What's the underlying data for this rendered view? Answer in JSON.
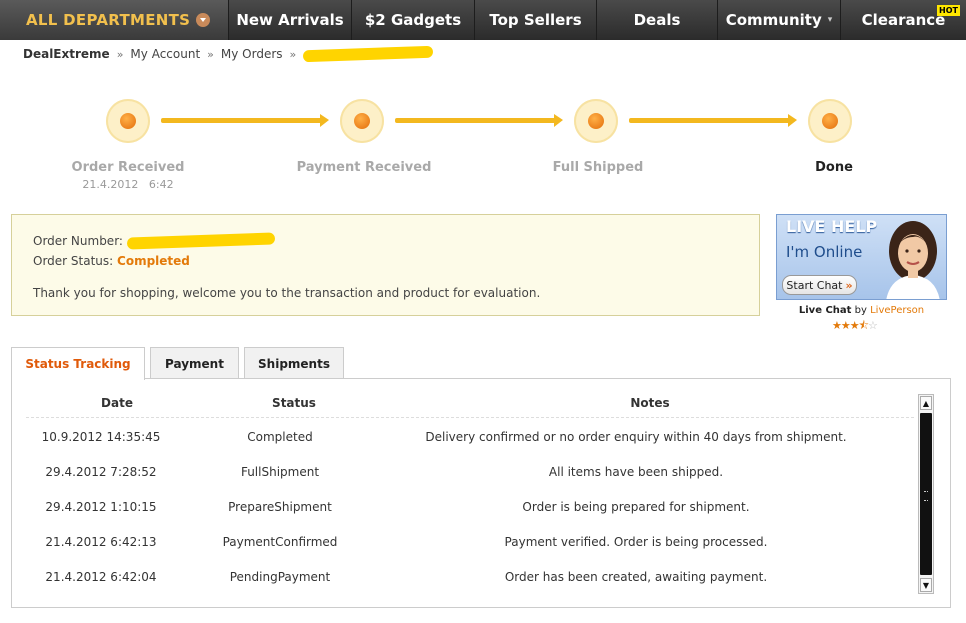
{
  "nav": {
    "departments": "ALL DEPARTMENTS",
    "items": [
      "New Arrivals",
      "$2 Gadgets",
      "Top Sellers",
      "Deals",
      "Community",
      "Clearance"
    ],
    "hot_badge": "HOT"
  },
  "breadcrumb": {
    "home": "DealExtreme",
    "account": "My Account",
    "orders": "My Orders"
  },
  "progress": {
    "steps": [
      {
        "label": "Order Received",
        "date": "21.4.2012   6:42"
      },
      {
        "label": "Payment Received"
      },
      {
        "label": "Full Shipped"
      },
      {
        "label": "Done"
      }
    ]
  },
  "order": {
    "number_label": "Order Number:",
    "status_label": "Order Status:",
    "status_value": "Completed",
    "thanks": "Thank you for shopping, welcome you to the transaction and product for evaluation."
  },
  "livehelp": {
    "title": "LIVE HELP",
    "online": "I'm Online",
    "button": "Start Chat",
    "caption_bold": "Live Chat",
    "caption_by": "by",
    "caption_brand": "LivePerson",
    "rating": 3.5
  },
  "tabs": [
    "Status Tracking",
    "Payment",
    "Shipments"
  ],
  "table": {
    "headers": [
      "Date",
      "Status",
      "Notes"
    ],
    "rows": [
      [
        "10.9.2012 14:35:45",
        "Completed",
        "Delivery confirmed or no order enquiry within 40 days from shipment."
      ],
      [
        "29.4.2012 7:28:52",
        "FullShipment",
        "All items have been shipped."
      ],
      [
        "29.4.2012 1:10:15",
        "PrepareShipment",
        "Order is being prepared for shipment."
      ],
      [
        "21.4.2012 6:42:13",
        "PaymentConfirmed",
        "Payment verified. Order is being processed."
      ],
      [
        "21.4.2012 6:42:04",
        "PendingPayment",
        "Order has been created, awaiting payment."
      ]
    ]
  }
}
